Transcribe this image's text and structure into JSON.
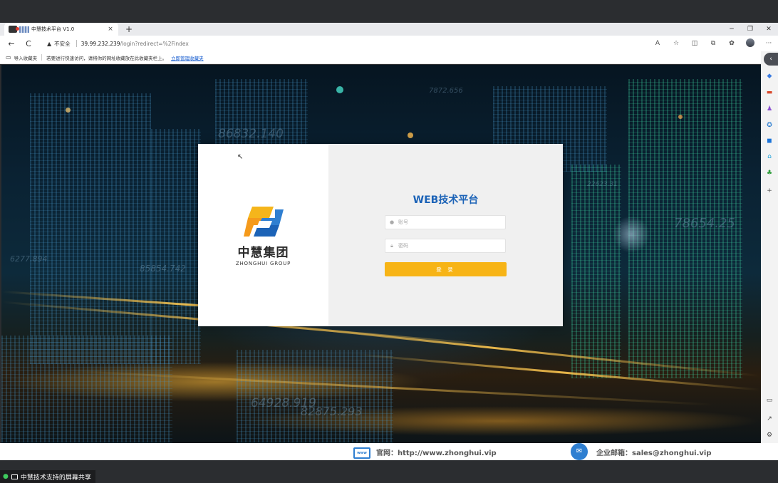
{
  "browser": {
    "tab_title": "中慧技术平台 V1.0",
    "tab_close": "×",
    "new_tab": "+",
    "window_controls": {
      "minimize": "−",
      "restore": "❐",
      "close": "✕"
    },
    "nav": {
      "back": "←",
      "reload": "C"
    },
    "address": {
      "security_label": "不安全",
      "host": "39.99.232.239",
      "path": "/login?redirect=%2Findex"
    },
    "toolbar_icons": [
      "read-aloud-icon",
      "favorite-star-icon",
      "split-screen-icon",
      "collections-icon",
      "extensions-icon",
      "profile-avatar-icon",
      "more-menu-icon"
    ],
    "toolbar_glyphs": {
      "read_aloud": "A",
      "favorite": "☆",
      "split": "◫",
      "collections": "⧉",
      "extensions": "✿",
      "more": "···"
    },
    "favorites_bar": {
      "import_label": "导入收藏夹",
      "hint_text": "若要进行快速访问，请将你的网址收藏放在此收藏夹栏上。",
      "manage_link": "立即管理收藏夹"
    }
  },
  "background_numbers": [
    "86832.140",
    "7872.656",
    "6277.894",
    "85854.742",
    "64928.919",
    "82875.293",
    "22623.31",
    "78654.25"
  ],
  "login": {
    "logo_cn": "中慧集团",
    "logo_en": "ZHONGHUI GROUP",
    "title": "WEB技术平台",
    "username_placeholder": "账号",
    "password_placeholder": "密码",
    "submit_label": "登 录"
  },
  "footer": {
    "website_label": "官网：http://www.zhonghui.vip",
    "website_icon_text": "www",
    "email_label": "企业邮箱：sales@zhonghui.vip"
  },
  "screen_share": {
    "label": "中慧技术支持的屏幕共享"
  },
  "colors": {
    "accent_blue": "#1c63b7",
    "login_button": "#f7b416",
    "logo_blue": "#2f7fd1",
    "logo_yellow": "#f5b51b"
  }
}
